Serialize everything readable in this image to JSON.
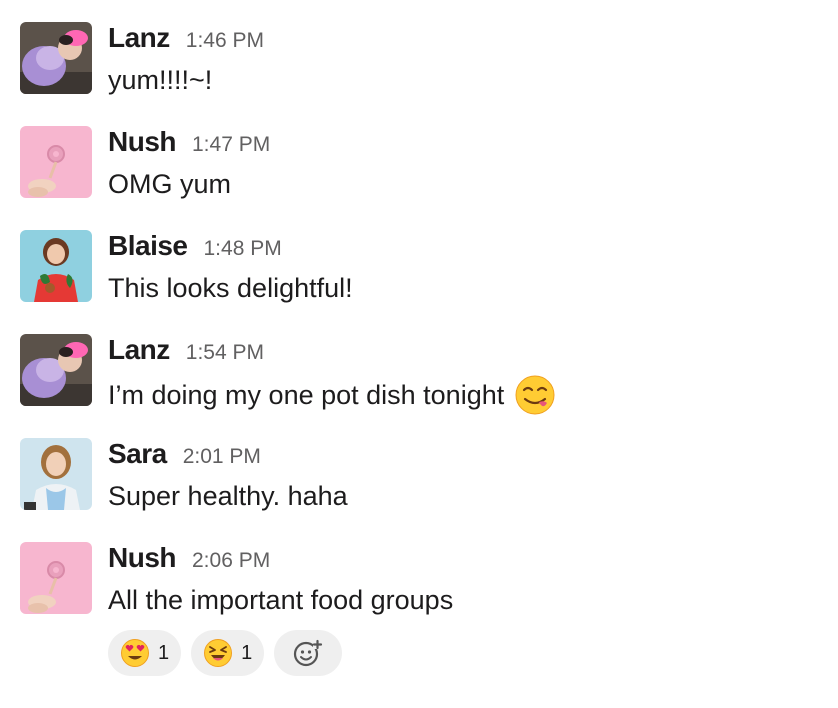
{
  "messages": [
    {
      "name": "Lanz",
      "time": "1:46 PM",
      "text": "yum!!!!~!",
      "avatar": "lanz-avatar"
    },
    {
      "name": "Nush",
      "time": "1:47 PM",
      "text": "OMG yum",
      "avatar": "nush-avatar"
    },
    {
      "name": "Blaise",
      "time": "1:48 PM",
      "text": "This looks delightful!",
      "avatar": "blaise-avatar"
    },
    {
      "name": "Lanz",
      "time": "1:54 PM",
      "text": "I’m doing my one pot dish tonight",
      "avatar": "lanz-avatar",
      "emoji": "yum-face-emoji"
    },
    {
      "name": "Sara",
      "time": "2:01 PM",
      "text": "Super healthy. haha",
      "avatar": "sara-avatar"
    },
    {
      "name": "Nush",
      "time": "2:06 PM",
      "text": "All the important food groups",
      "avatar": "nush-avatar"
    }
  ],
  "reactions": [
    {
      "emoji": "heart-eyes-emoji",
      "count": "1"
    },
    {
      "emoji": "laughing-squint-emoji",
      "count": "1"
    },
    {
      "emoji": "add-reaction-icon"
    }
  ],
  "colors": {
    "text": "#1d1c1d",
    "timestamp": "#616061",
    "reaction_bg": "#efefef",
    "nush_pink": "#f7b6cf",
    "blaise_blue": "#8fd0e0",
    "sara_blue": "#cfe4ee"
  }
}
